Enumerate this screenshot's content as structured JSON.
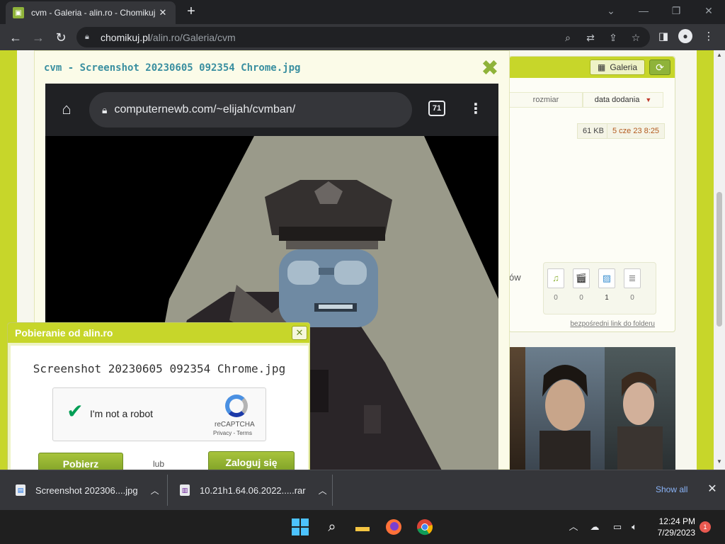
{
  "browser": {
    "tab_title": "cvm - Galeria - alin.ro - Chomikuj",
    "url_host": "chomikuj.pl",
    "url_path": "/alin.ro/Galeria/cvm"
  },
  "lightbox": {
    "title": "cvm - Screenshot 20230605 092354 Chrome.jpg",
    "photo": {
      "url": "computernewb.com/~elijah/cvmban/",
      "tab_count": "71"
    }
  },
  "right_panel": {
    "galeria_label": "Galeria",
    "columns": [
      "rozmiar",
      "data dodania"
    ],
    "sort_arrow": "▼",
    "file_size": "61 KB",
    "file_date": "5 cze 23 8:25",
    "ow_text": "ów",
    "type_counts": [
      "0",
      "0",
      "1",
      "0"
    ],
    "folder_link": "bezpośredni link do folderu"
  },
  "download_dialog": {
    "title": "Pobieranie od alin.ro",
    "file_name": "Screenshot 20230605 092354 Chrome.jpg",
    "captcha_label": "I'm not a robot",
    "captcha_brand": "reCAPTCHA",
    "captcha_terms": "Privacy - Terms",
    "download_button": "Pobierz",
    "or_text": "lub",
    "login_button": "Zaloguj się"
  },
  "download_shelf": {
    "items": [
      {
        "name": "Screenshot 202306....jpg"
      },
      {
        "name": "10.21h1.64.06.2022.....rar"
      }
    ],
    "show_all": "Show all"
  },
  "taskbar": {
    "time": "12:24 PM",
    "date": "7/29/2023",
    "notifications": "1"
  },
  "colors": {
    "brand_green": "#c7d62a",
    "button_green": "#8fb33a",
    "title_teal": "#3a8fa0"
  }
}
